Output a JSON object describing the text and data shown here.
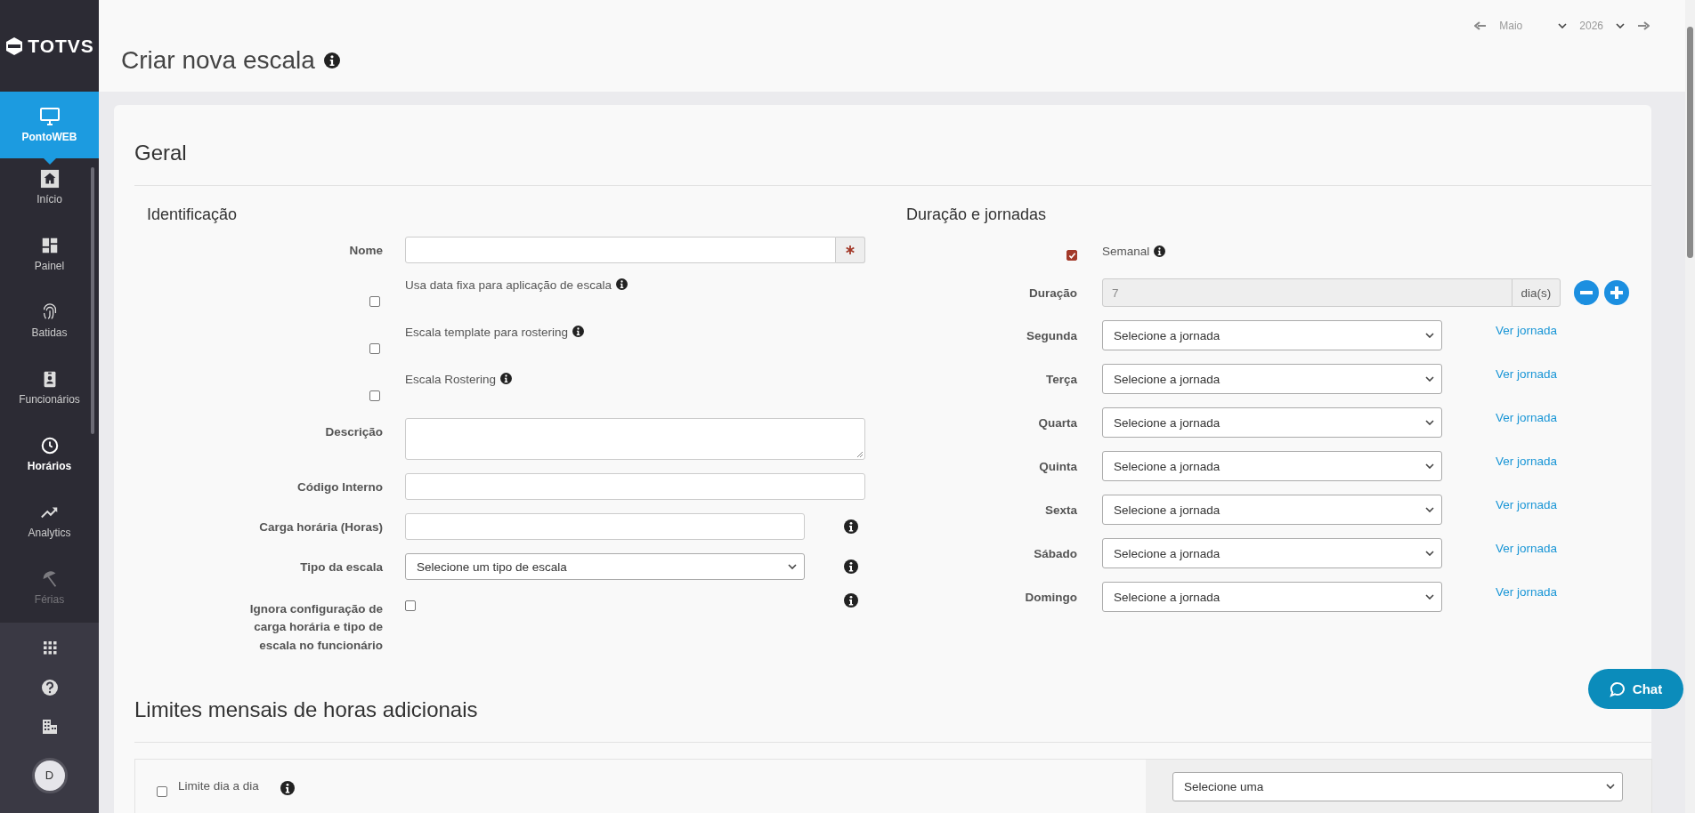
{
  "sidebar": {
    "logo": "TOTVS",
    "module": {
      "label": "PontoWEB"
    },
    "items": [
      {
        "kind": "home",
        "label": "Início",
        "selected": false
      },
      {
        "kind": "dashboard",
        "label": "Painel",
        "selected": false
      },
      {
        "kind": "fingerprint",
        "label": "Batidas",
        "selected": false
      },
      {
        "kind": "badge",
        "label": "Funcionários",
        "selected": false
      },
      {
        "kind": "clock",
        "label": "Horários",
        "selected": true
      },
      {
        "kind": "trend",
        "label": "Analytics",
        "selected": false
      },
      {
        "kind": "umbrella",
        "label": "Férias",
        "selected": false
      }
    ],
    "avatar": "D"
  },
  "date_nav": {
    "month": "Maio",
    "year": "2026"
  },
  "page": {
    "title": "Criar nova escala"
  },
  "geral": {
    "title": "Geral",
    "identificacao": {
      "title": "Identificação",
      "fields": [
        {
          "kind": "required-text",
          "label": "Nome"
        },
        {
          "kind": "checkbox",
          "label": "Usa data fixa para aplicação de escala",
          "checked": false
        },
        {
          "kind": "checkbox",
          "label": "Escala template para rostering",
          "checked": false
        },
        {
          "kind": "checkbox",
          "label": "Escala Rostering",
          "checked": false
        },
        {
          "kind": "textarea",
          "label": "Descrição"
        },
        {
          "kind": "text",
          "label": "Código Interno"
        },
        {
          "kind": "text-info",
          "label": "Carga horária (Horas)"
        },
        {
          "kind": "select-info",
          "label": "Tipo da escala",
          "value": "Selecione um tipo de escala"
        },
        {
          "kind": "inline-checkbox-info",
          "label": "Ignora configuração de carga horária e tipo de escala no funcionário",
          "checked": false
        }
      ]
    },
    "duracao": {
      "title": "Duração e jornadas",
      "semanal": {
        "label": "Semanal",
        "checked": true
      },
      "duration": {
        "label": "Duração",
        "value": "7",
        "unit": "dia(s)"
      },
      "days": [
        {
          "label": "Segunda",
          "value": "Selecione a jornada",
          "link": "Ver jornada"
        },
        {
          "label": "Terça",
          "value": "Selecione a jornada",
          "link": "Ver jornada"
        },
        {
          "label": "Quarta",
          "value": "Selecione a jornada",
          "link": "Ver jornada"
        },
        {
          "label": "Quinta",
          "value": "Selecione a jornada",
          "link": "Ver jornada"
        },
        {
          "label": "Sexta",
          "value": "Selecione a jornada",
          "link": "Ver jornada"
        },
        {
          "label": "Sábado",
          "value": "Selecione a jornada",
          "link": "Ver jornada"
        },
        {
          "label": "Domingo",
          "value": "Selecione a jornada",
          "link": "Ver jornada"
        }
      ]
    }
  },
  "limites": {
    "title": "Limites mensais de horas adicionais",
    "limite_dia": {
      "label": "Limite dia a dia",
      "checked": false
    },
    "select": {
      "value": "Selecione uma"
    }
  },
  "chat": {
    "label": "Chat"
  }
}
